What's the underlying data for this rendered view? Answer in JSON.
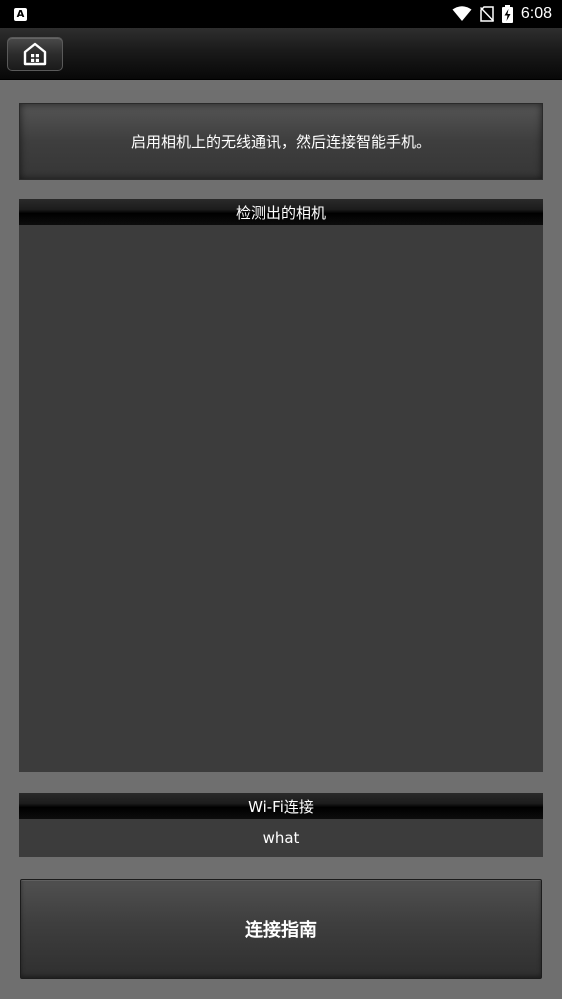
{
  "status_bar": {
    "notification_icon_label": "A",
    "time": "6:08",
    "icons": [
      "wifi-icon",
      "no-sim-icon",
      "battery-charging-icon"
    ]
  },
  "toolbar": {
    "home_icon": "home-icon"
  },
  "message": {
    "text": "启用相机上的无线通讯，然后连接智能手机。"
  },
  "camera_section": {
    "title": "检测出的相机",
    "items": []
  },
  "wifi_section": {
    "title": "Wi-Fi连接",
    "value": "what"
  },
  "guide_button": {
    "label": "连接指南"
  },
  "colors": {
    "background": "#6f6f6f",
    "panel": "#3c3c3c",
    "status_bar": "#000000",
    "text": "#ffffff"
  }
}
